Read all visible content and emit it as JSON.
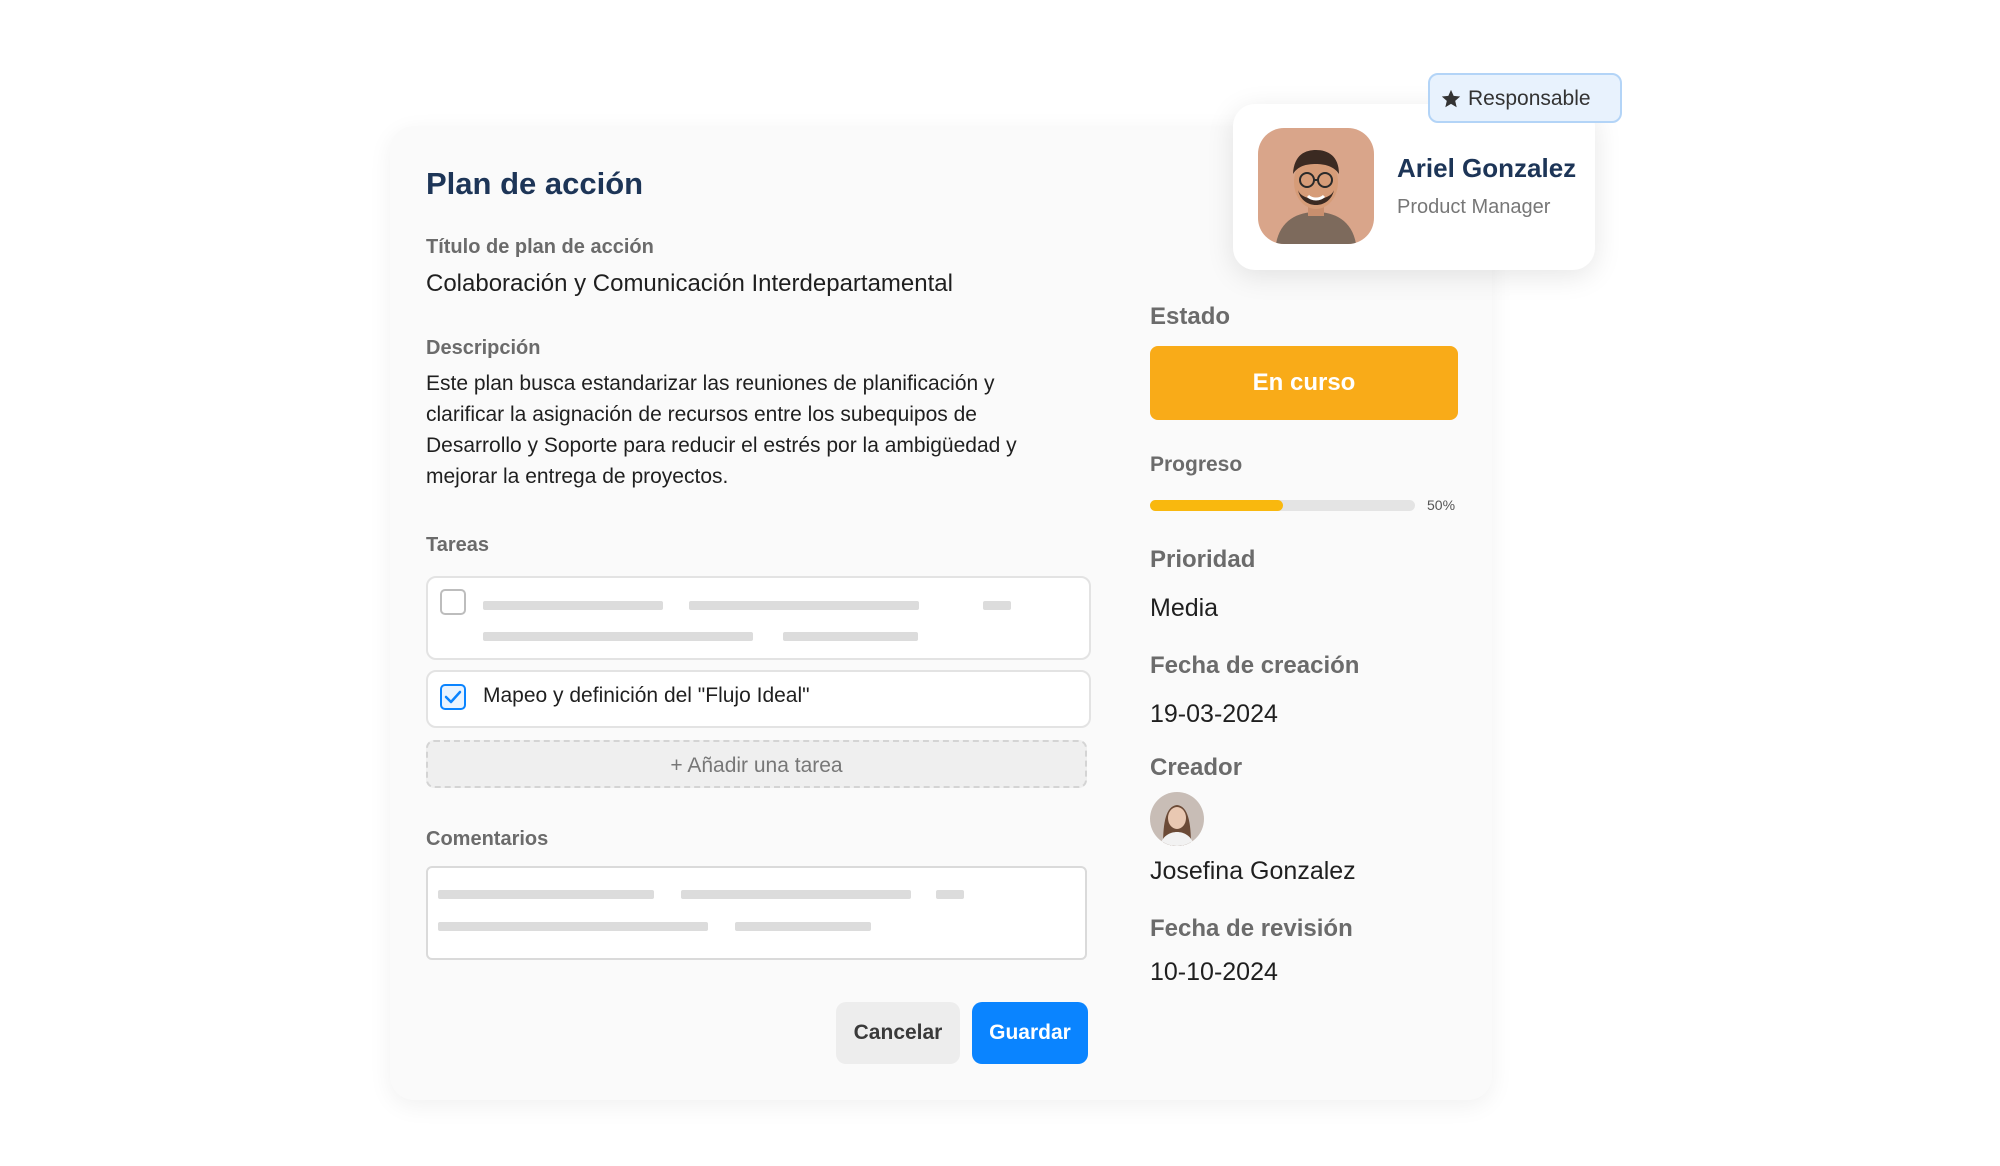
{
  "form": {
    "title": "Plan de acción",
    "plan_title_label": "Título de plan de acción",
    "plan_title_value": "Colaboración y Comunicación Interdepartamental",
    "description_label": "Descripción",
    "description_value": "Este plan busca estandarizar las reuniones de planificación y clarificar la asignación de recursos entre los subequipos de Desarrollo y Soporte para reducir el estrés por la ambigüedad y mejorar la entrega de proyectos.",
    "tasks_label": "Tareas",
    "tasks": [
      {
        "label": "",
        "checked": false
      },
      {
        "label": "Mapeo y definición del \"Flujo Ideal\"",
        "checked": true
      }
    ],
    "add_task_label": "+ Añadir una tarea",
    "comments_label": "Comentarios",
    "cancel_label": "Cancelar",
    "save_label": "Guardar"
  },
  "sidebar": {
    "status_label": "Estado",
    "status_value": "En curso",
    "progress_label": "Progreso",
    "progress_value": 0.5,
    "progress_text": "50%",
    "priority_label": "Prioridad",
    "priority_value": "Media",
    "created_label": "Fecha de creación",
    "created_value": "19-03-2024",
    "creator_label": "Creador",
    "creator_name": "Josefina Gonzalez",
    "review_label": "Fecha de revisión",
    "review_value": "10-10-2024"
  },
  "responsible": {
    "badge_label": "Responsable",
    "badge_icon": "star-icon",
    "name": "Ariel Gonzalez",
    "role": "Product Manager"
  },
  "colors": {
    "title": "#1d3557",
    "status": "#f9ab18",
    "progress": "#f9b80e",
    "primary_button": "#0a84ff",
    "check": "#0a84ff"
  }
}
